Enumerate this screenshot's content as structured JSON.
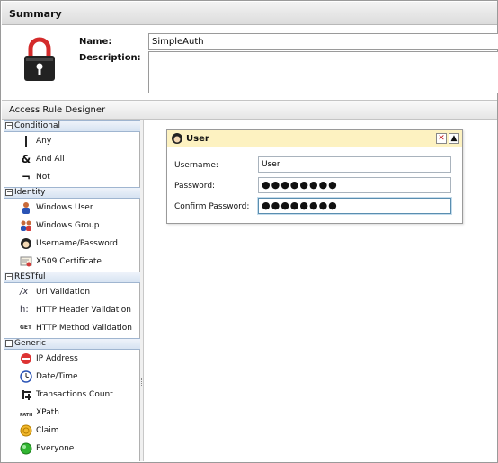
{
  "summary": {
    "title": "Summary",
    "name_label": "Name:",
    "name_value": "SimpleAuth",
    "description_label": "Description:",
    "description_value": ""
  },
  "designer": {
    "title": "Access Rule Designer"
  },
  "toolbox": {
    "groups": [
      {
        "label": "Conditional",
        "items": [
          {
            "label": "Any",
            "icon": "pipe-icon"
          },
          {
            "label": "And All",
            "icon": "ampersand-icon"
          },
          {
            "label": "Not",
            "icon": "not-icon"
          }
        ]
      },
      {
        "label": "Identity",
        "items": [
          {
            "label": "Windows User",
            "icon": "windows-user-icon"
          },
          {
            "label": "Windows Group",
            "icon": "windows-group-icon"
          },
          {
            "label": "Username/Password",
            "icon": "username-password-icon"
          },
          {
            "label": "X509 Certificate",
            "icon": "certificate-icon"
          }
        ]
      },
      {
        "label": "RESTful",
        "items": [
          {
            "label": "Url Validation",
            "icon": "url-regex-icon"
          },
          {
            "label": "HTTP Header Validation",
            "icon": "http-header-icon"
          },
          {
            "label": "HTTP Method Validation",
            "icon": "http-method-icon"
          }
        ]
      },
      {
        "label": "Generic",
        "items": [
          {
            "label": "IP Address",
            "icon": "ip-address-icon"
          },
          {
            "label": "Date/Time",
            "icon": "date-time-icon"
          },
          {
            "label": "Transactions Count",
            "icon": "transactions-count-icon"
          },
          {
            "label": "XPath",
            "icon": "xpath-icon"
          },
          {
            "label": "Claim",
            "icon": "claim-icon"
          },
          {
            "label": "Everyone",
            "icon": "everyone-icon"
          }
        ]
      }
    ],
    "icon_glyphs": {
      "method": "GET",
      "header": "h:",
      "url": "/x",
      "xpath": "PATH"
    }
  },
  "user_panel": {
    "title": "User",
    "close_glyph": "✕",
    "collapse_glyph": "▲",
    "username_label": "Username:",
    "username_value": "User",
    "password_label": "Password:",
    "password_value": "●●●●●●●●",
    "confirm_label": "Confirm Password:",
    "confirm_value": "●●●●●●●●"
  },
  "colors": {
    "panel_title_bg": "#fdf2c1",
    "group_header_bg": "#d7e3f2",
    "lock_red": "#d42b2b"
  }
}
